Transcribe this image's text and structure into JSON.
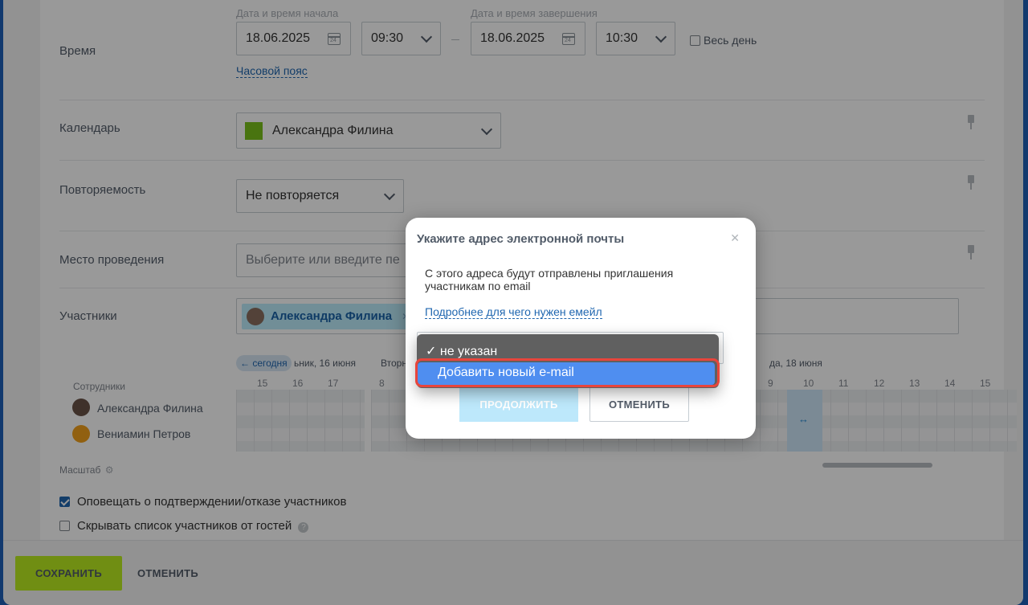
{
  "form": {
    "time_label": "Время",
    "start_caption": "Дата и время начала",
    "end_caption": "Дата и время завершения",
    "start_date": "18.06.2025",
    "start_time": "09:30",
    "end_date": "18.06.2025",
    "end_time": "10:30",
    "all_day_label": "Весь день",
    "timezone_link": "Часовой пояс",
    "calendar_label": "Календарь",
    "calendar_value": "Александра Филина",
    "calendar_color": "#7bc11b",
    "repeat_label": "Повторяемость",
    "repeat_value": "Не повторяется",
    "location_label": "Место проведения",
    "location_placeholder": "Выберите или введите пе",
    "participants_label": "Участники",
    "participant_chip": "Александра Филина",
    "planner": {
      "today_button": "← сегодня",
      "day_left": "ьник, 16 июня",
      "day_mid": "Вторн",
      "day_right": "да, 18 июня",
      "staff_header": "Сотрудники",
      "hours_left": [
        "15",
        "16",
        "17"
      ],
      "hours_mid": [
        "8"
      ],
      "hours_right": [
        "9",
        "10",
        "11",
        "12",
        "13",
        "14",
        "15"
      ],
      "staff": [
        "Александра Филина",
        "Вениамин Петров"
      ]
    },
    "scale_label": "Масштаб",
    "notify_label": "Оповещать о подтверждении/отказе участников",
    "notify_checked": true,
    "hide_label": "Скрывать список участников от гостей",
    "hide_checked": false
  },
  "footer": {
    "save_label": "СОХРАНИТЬ",
    "cancel_label": "ОТМЕНИТЬ",
    "save_color": "#bbed21"
  },
  "modal": {
    "title": "Укажите адрес электронной почты",
    "description": "С этого адреса будут отправлены приглашения участникам по email",
    "more_link": "Подробнее для чего нужен емейл",
    "dropdown_options": [
      "не указан",
      "Добавить новый e-mail"
    ],
    "selected_option": "не указан",
    "highlighted_option": "Добавить новый e-mail",
    "continue_label": "ПРОДОЛЖИТЬ",
    "cancel_label": "ОТМЕНИТЬ",
    "highlight_color": "#e8453c"
  }
}
